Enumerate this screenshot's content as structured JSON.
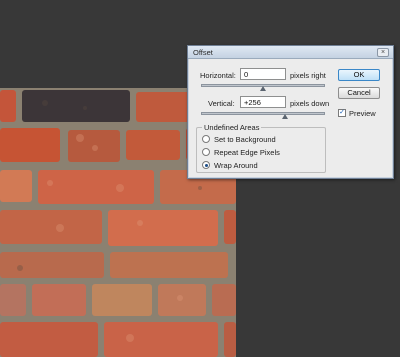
{
  "dialog": {
    "title": "Offset",
    "close_glyph": "×",
    "horizontal": {
      "label": "Horizontal:",
      "value": "0",
      "unit": "pixels right",
      "slider_level": 0.5
    },
    "vertical": {
      "label": "Vertical:",
      "value": "+256",
      "unit": "pixels down",
      "slider_level": 0.68
    },
    "buttons": {
      "ok": "OK",
      "cancel": "Cancel"
    },
    "preview": {
      "label": "Preview",
      "checked": true,
      "check_glyph": "✓"
    },
    "undefined_areas": {
      "title": "Undefined Areas",
      "options": [
        {
          "label": "Set to Background",
          "selected": false
        },
        {
          "label": "Repeat Edge Pixels",
          "selected": false
        },
        {
          "label": "Wrap Around",
          "selected": true
        }
      ]
    }
  },
  "colors": {
    "workspace": "#383838",
    "dialog_bg": "#ececec",
    "titlebar": "#c4d2e2",
    "accent": "#3a87c8"
  },
  "icons": {
    "close": "close-icon",
    "preview_check": "checkmark-icon"
  }
}
